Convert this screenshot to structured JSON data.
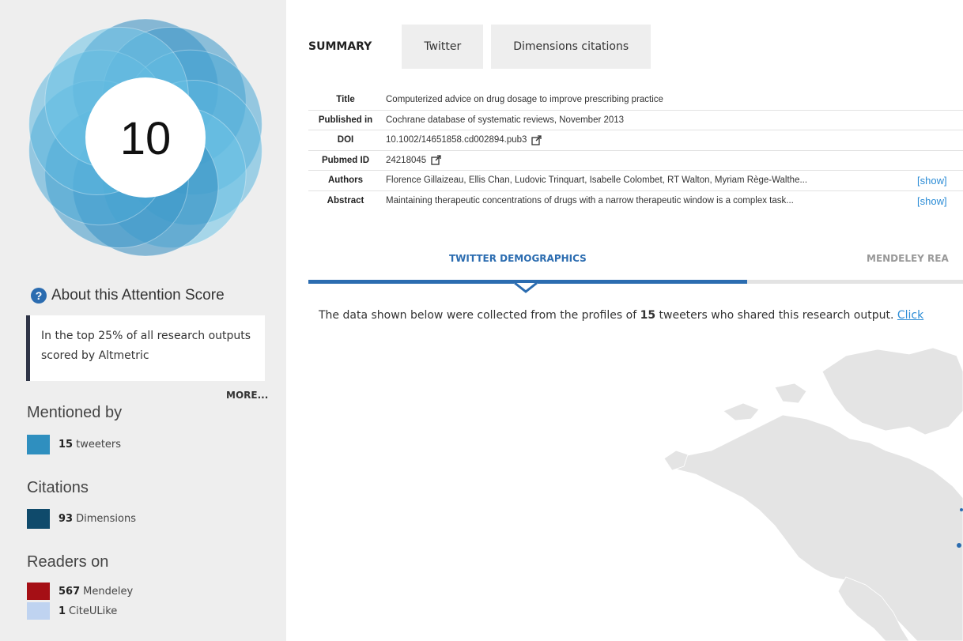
{
  "score": {
    "value": "10",
    "colors": [
      "#2f8bbf",
      "#3a98c9",
      "#4aa8d6",
      "#5bb6df",
      "#6cc3e6"
    ]
  },
  "about": {
    "title": "About this Attention Score",
    "box_text": "In the top 25% of all research outputs scored by Altmetric",
    "more": "MORE..."
  },
  "mentioned_by": {
    "heading": "Mentioned by",
    "items": [
      {
        "count": "15",
        "label": "tweeters",
        "color": "#2f8fbf"
      }
    ]
  },
  "citations": {
    "heading": "Citations",
    "items": [
      {
        "count": "93",
        "label": "Dimensions",
        "color": "#0f4a6b"
      }
    ]
  },
  "readers": {
    "heading": "Readers on",
    "items": [
      {
        "count": "567",
        "label": "Mendeley",
        "color": "#a50f15"
      },
      {
        "count": "1",
        "label": "CiteULike",
        "color": "#bfd3f0"
      }
    ]
  },
  "tabs": [
    {
      "label": "SUMMARY",
      "active": true
    },
    {
      "label": "Twitter",
      "active": false
    },
    {
      "label": "Dimensions citations",
      "active": false
    }
  ],
  "summary": {
    "title_label": "Title",
    "title": "Computerized advice on drug dosage to improve prescribing practice",
    "published_label": "Published in",
    "published": "Cochrane database of systematic reviews, November 2013",
    "doi_label": "DOI",
    "doi": "10.1002/14651858.cd002894.pub3",
    "pubmed_label": "Pubmed ID",
    "pubmed": "24218045",
    "authors_label": "Authors",
    "authors": "Florence Gillaizeau, Ellis Chan, Ludovic Trinquart, Isabelle Colombet, RT Walton, Myriam Rège-Walthe...",
    "abstract_label": "Abstract",
    "abstract": "Maintaining therapeutic concentrations of drugs with a narrow therapeutic window is a complex task...",
    "show_label": "[show]"
  },
  "demographics": {
    "tab1": "TWITTER DEMOGRAPHICS",
    "tab2": "MENDELEY REA",
    "desc_before": "The data shown below were collected from the profiles of ",
    "desc_count": "15",
    "desc_after": " tweeters who shared this research output. ",
    "desc_link": "Click"
  }
}
